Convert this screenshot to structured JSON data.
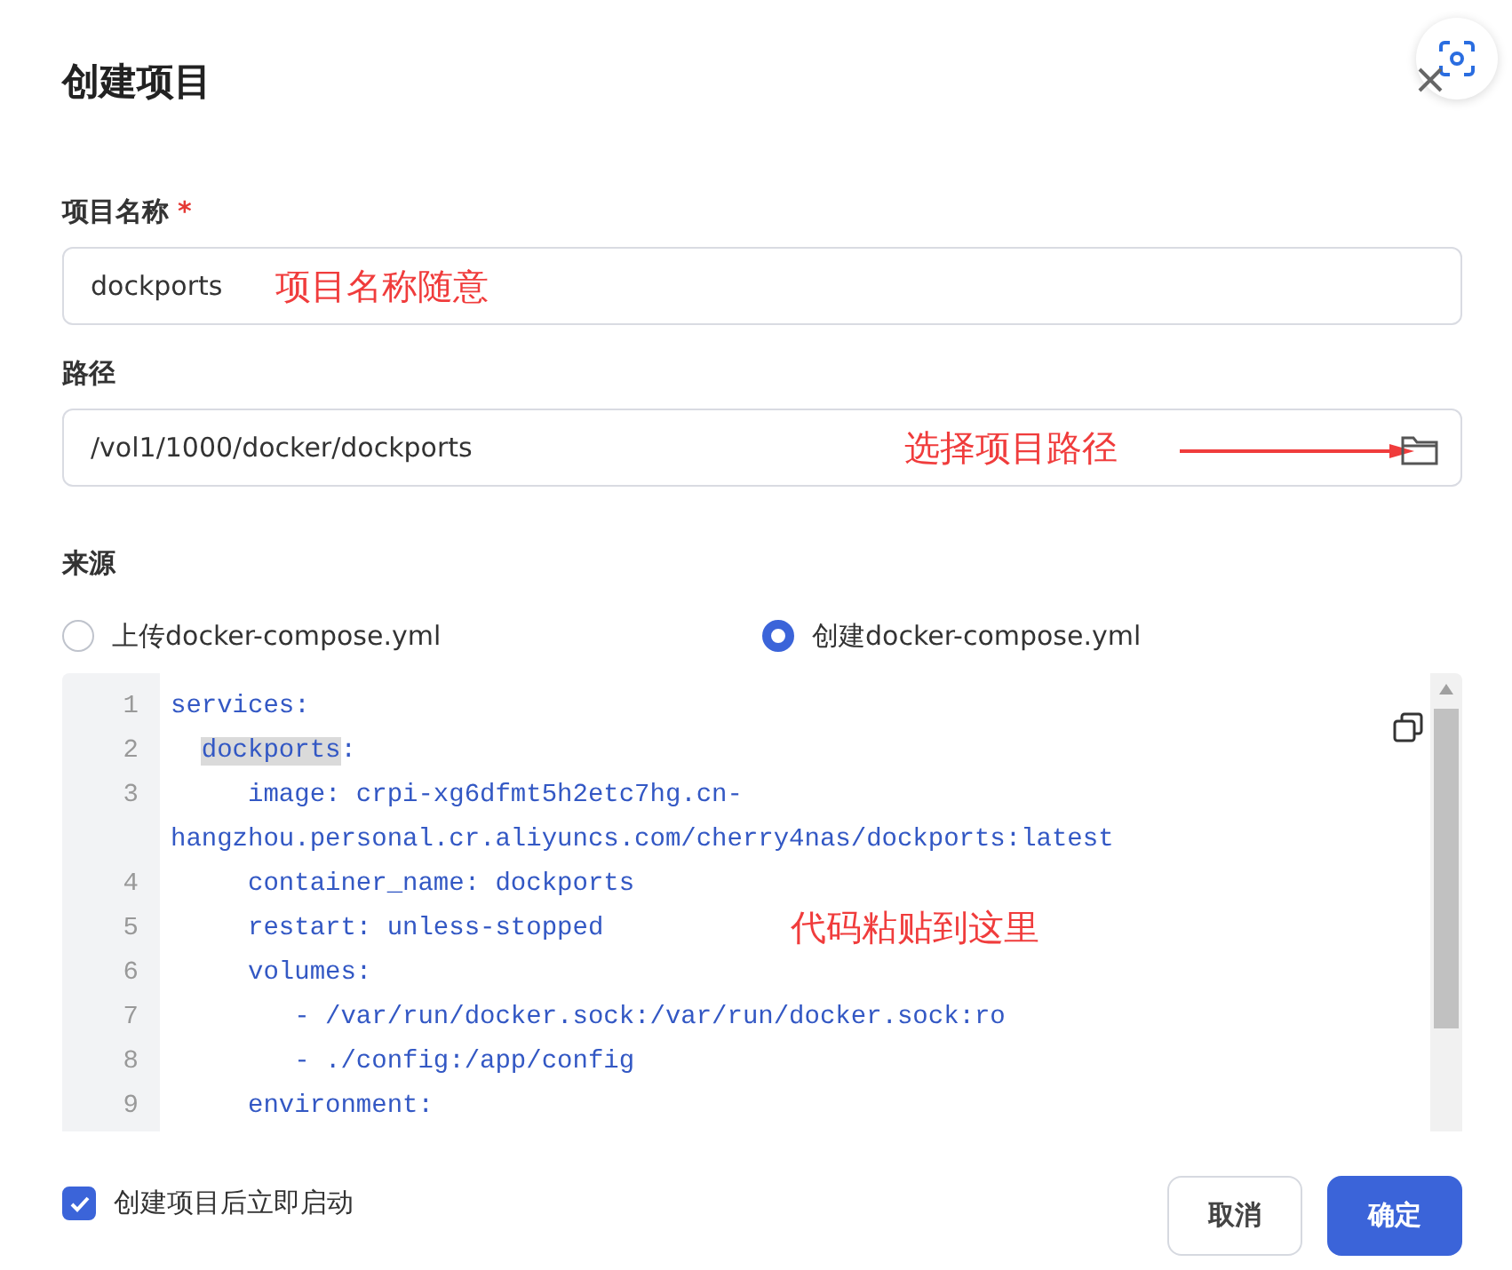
{
  "dialog": {
    "title": "创建项目"
  },
  "fields": [
    {
      "label": "项目名称",
      "required_mark": "*",
      "value": "dockports",
      "annotation": "项目名称随意",
      "kind": "text"
    },
    {
      "label": "路径",
      "value": "/vol1/1000/docker/dockports",
      "annotation": "选择项目路径",
      "kind": "folder"
    }
  ],
  "source": {
    "label": "来源",
    "options": [
      {
        "label": "上传docker-compose.yml",
        "selected": false
      },
      {
        "label": "创建docker-compose.yml",
        "selected": true
      }
    ]
  },
  "editor": {
    "annotation": "代码粘贴到这里",
    "lines": [
      {
        "number": "1",
        "text": "services:"
      },
      {
        "number": "2",
        "token": "  dockports",
        "suffix": ":",
        "highlighted": true
      },
      {
        "number": "3",
        "text": "     image: crpi-xg6dfmt5h2etc7hg.cn-",
        "wrapped": "hangzhou.personal.cr.aliyuncs.com/cherry4nas/dockports:latest"
      },
      {
        "number": "4",
        "text": "     container_name: dockports"
      },
      {
        "number": "5",
        "text": "     restart: unless-stopped"
      },
      {
        "number": "6",
        "text": "     volumes:"
      },
      {
        "number": "7",
        "text": "        - /var/run/docker.sock:/var/run/docker.sock:ro"
      },
      {
        "number": "8",
        "text": "        - ./config:/app/config"
      },
      {
        "number": "9",
        "text": "     environment:"
      }
    ]
  },
  "start_after_create": {
    "label": "创建项目后立即启动",
    "checked": true
  },
  "buttons": [
    {
      "label": "取消",
      "kind": "secondary"
    },
    {
      "label": "确定",
      "kind": "primary"
    }
  ]
}
